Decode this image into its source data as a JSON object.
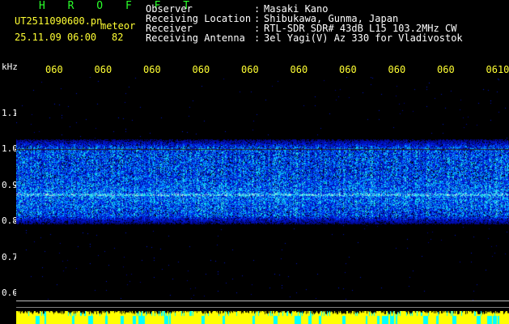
{
  "header": {
    "app_name": "H R O F F T",
    "filename": "UT2511090600.pn",
    "meteor_label": "meteor",
    "datetime": "25.11.09 06:00",
    "count": "82"
  },
  "info": [
    {
      "key": "Observer",
      "value": "Masaki Kano"
    },
    {
      "key": "Receiving Location",
      "value": "Shibukawa, Gunma, Japan"
    },
    {
      "key": "Receiver",
      "value": "RTL-SDR SDR# 43dB L15 103.2MHz CW"
    },
    {
      "key": "Receiving Antenna",
      "value": "3el Yagi(V) Az 330 for Vladivostok"
    }
  ],
  "chart_data": {
    "type": "heatmap",
    "ylabel": "kHz",
    "y_ticks": [
      "1.1",
      "1.0",
      "0.9",
      "0.8",
      "0.7",
      "0.6"
    ],
    "x_tick_labels": [
      "060",
      "060",
      "060",
      "060",
      "060",
      "060",
      "060",
      "060",
      "060",
      "0610"
    ],
    "signal_band_khz": [
      0.79,
      1.03
    ],
    "carrier_khz": 0.875,
    "ylim": [
      0.58,
      1.2
    ],
    "colors": {
      "background": "#000000",
      "low": "#0000ff",
      "mid": "#00aaff",
      "high": "#00ffcc",
      "bars_a": "#ffff00",
      "bars_b": "#00ffff"
    }
  }
}
